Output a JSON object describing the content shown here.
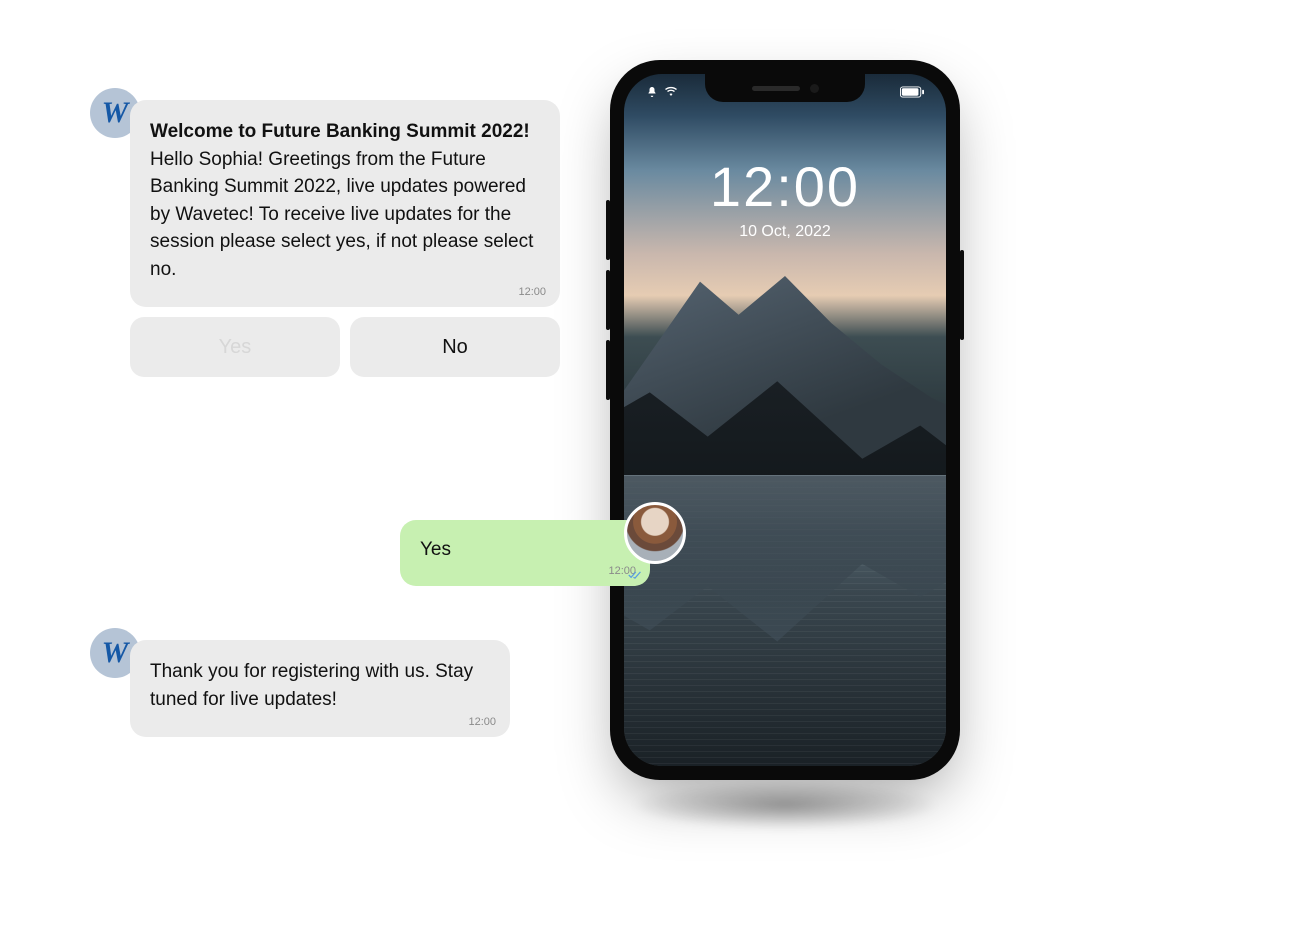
{
  "phone": {
    "time": "12:00",
    "date": "10 Oct, 2022",
    "icons": {
      "bell": "bell-icon",
      "wifi": "wifi-icon",
      "battery": "battery-icon"
    }
  },
  "chat": {
    "brand_initial": "W",
    "messages": {
      "welcome": {
        "title": "Welcome to Future Banking Summit 2022!",
        "body": "Hello Sophia! Greetings from the Future Banking Summit 2022, live updates powered by Wavetec! To receive live updates for the session please select yes, if not please select no.",
        "time": "12:00"
      },
      "options": {
        "yes": "Yes",
        "no": "No"
      },
      "user_reply": {
        "text": "Yes",
        "time": "12:00"
      },
      "thanks": {
        "body": "Thank you for registering with us. Stay tuned for live updates!",
        "time": "12:00"
      }
    }
  }
}
